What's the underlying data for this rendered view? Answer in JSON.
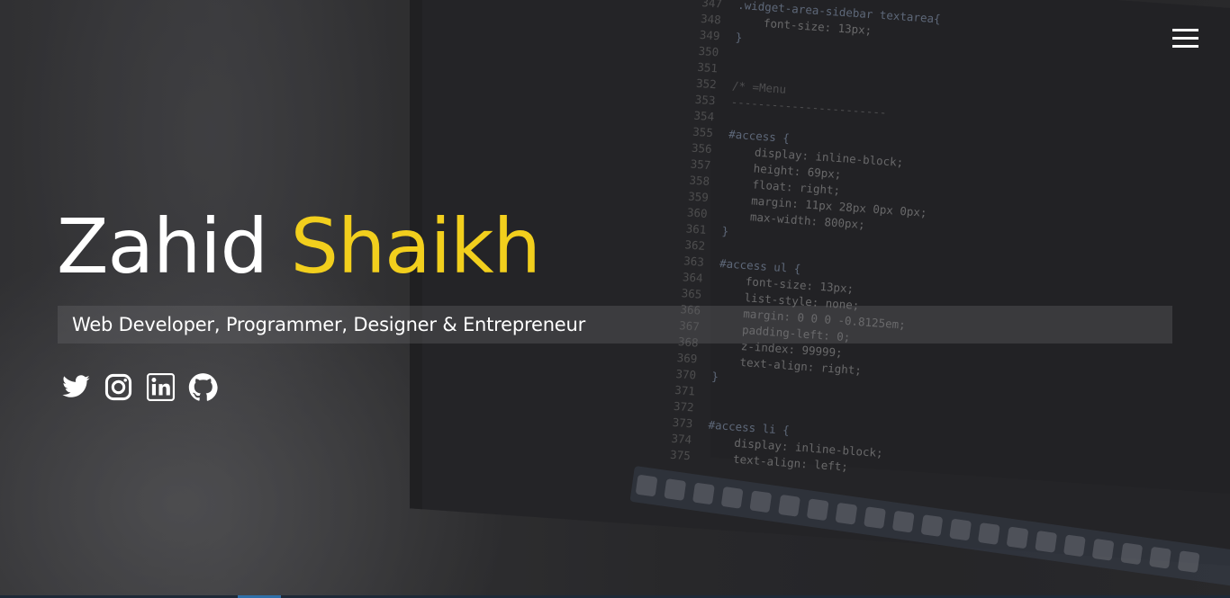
{
  "hero": {
    "first_name": "Zahid",
    "last_name": "Shaikh",
    "tagline": "Web Developer, Programmer, Designer & Entrepreneur",
    "accent_color": "#f2cf1d"
  },
  "menu": {
    "icon": "hamburger-menu-icon"
  },
  "social": [
    {
      "icon": "twitter-icon"
    },
    {
      "icon": "instagram-icon"
    },
    {
      "icon": "linkedin-icon"
    },
    {
      "icon": "github-icon"
    }
  ],
  "background_code": {
    "lines": [
      {
        "n": "347",
        "text": ".widget-area-sidebar textarea{"
      },
      {
        "n": "348",
        "text": "    font-size: 13px;"
      },
      {
        "n": "349",
        "text": "}"
      },
      {
        "n": "350",
        "text": ""
      },
      {
        "n": "351",
        "text": ""
      },
      {
        "n": "352",
        "text": "/* =Menu"
      },
      {
        "n": "353",
        "text": "-----------------------"
      },
      {
        "n": "354",
        "text": ""
      },
      {
        "n": "355",
        "text": "#access {"
      },
      {
        "n": "356",
        "text": "    display: inline-block;"
      },
      {
        "n": "357",
        "text": "    height: 69px;"
      },
      {
        "n": "358",
        "text": "    float: right;"
      },
      {
        "n": "359",
        "text": "    margin: 11px 28px 0px 0px;"
      },
      {
        "n": "360",
        "text": "    max-width: 800px;"
      },
      {
        "n": "361",
        "text": "}"
      },
      {
        "n": "362",
        "text": ""
      },
      {
        "n": "363",
        "text": "#access ul {"
      },
      {
        "n": "364",
        "text": "    font-size: 13px;"
      },
      {
        "n": "365",
        "text": "    list-style: none;"
      },
      {
        "n": "366",
        "text": "    margin: 0 0 0 -0.8125em;"
      },
      {
        "n": "367",
        "text": "    padding-left: 0;"
      },
      {
        "n": "368",
        "text": "    z-index: 99999;"
      },
      {
        "n": "369",
        "text": "    text-align: right;"
      },
      {
        "n": "370",
        "text": "}"
      },
      {
        "n": "371",
        "text": ""
      },
      {
        "n": "372",
        "text": ""
      },
      {
        "n": "373",
        "text": "#access li {"
      },
      {
        "n": "374",
        "text": "    display: inline-block;"
      },
      {
        "n": "375",
        "text": "    text-align: left;"
      }
    ]
  }
}
